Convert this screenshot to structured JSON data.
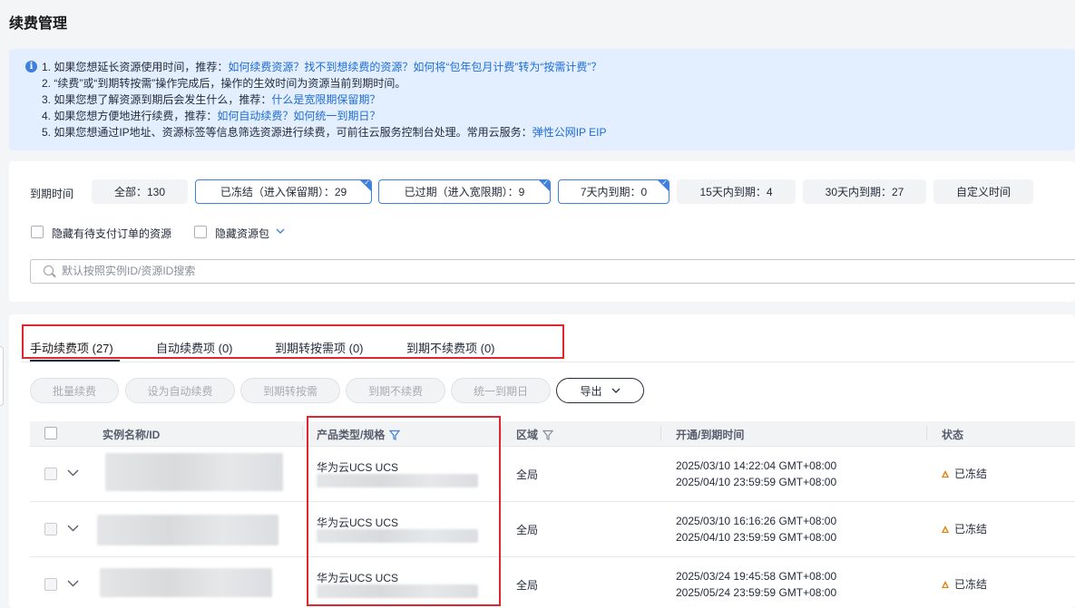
{
  "page": {
    "title": "续费管理"
  },
  "info": {
    "lines": [
      {
        "text": "1. 如果您想延长资源使用时间，推荐：",
        "link": "如何续费资源？找不到想续费的资源？如何将“包年包月计费”转为“按需计费”？"
      },
      {
        "text": "2. “续费”或“到期转按需”操作完成后，操作的生效时间为资源当前到期时间。",
        "link": ""
      },
      {
        "text": "3. 如果您想了解资源到期后会发生什么，推荐：",
        "link": "什么是宽限期保留期？"
      },
      {
        "text": "4. 如果您想方便地进行续费，推荐：",
        "link": "如何自动续费？如何统一到期日？"
      },
      {
        "text": "5. 如果您想通过IP地址、资源标签等信息筛选资源进行续费，可前往云服务控制台处理。常用云服务：",
        "link": "弹性公网IP EIP"
      }
    ]
  },
  "filter": {
    "label": "到期时间",
    "chips": [
      {
        "label": "全部：130",
        "selected": false
      },
      {
        "label": "已冻结（进入保留期）：29",
        "selected": true
      },
      {
        "label": "已过期（进入宽限期）：9",
        "selected": true
      },
      {
        "label": "7天内到期：0",
        "selected": true
      },
      {
        "label": "15天内到期：4",
        "selected": false
      },
      {
        "label": "30天内到期：27",
        "selected": false
      },
      {
        "label": "自定义时间",
        "selected": false
      }
    ],
    "checkbox_hide_pending": "隐藏有待支付订单的资源",
    "checkbox_hide_package": "隐藏资源包",
    "search_placeholder": "默认按照实例ID/资源ID搜索"
  },
  "tabs": [
    {
      "label": "手动续费项 (27)",
      "active": true
    },
    {
      "label": "自动续费项 (0)",
      "active": false
    },
    {
      "label": "到期转按需项 (0)",
      "active": false
    },
    {
      "label": "到期不续费项 (0)",
      "active": false
    }
  ],
  "toolbar": {
    "batch_renew": "批量续费",
    "set_auto_renew": "设为自动续费",
    "to_on_demand": "到期转按需",
    "no_renew": "到期不续费",
    "unify_expiry": "统一到期日",
    "export": "导出"
  },
  "table": {
    "headers": {
      "name": "实例名称/ID",
      "product": "产品类型/规格",
      "region": "区域",
      "time": "开通/到期时间",
      "status": "状态"
    },
    "rows": [
      {
        "product": "华为云UCS UCS",
        "region": "全局",
        "open": "2025/03/10 14:22:04 GMT+08:00",
        "expire": "2025/04/10 23:59:59 GMT+08:00",
        "status": "已冻结"
      },
      {
        "product": "华为云UCS UCS",
        "region": "全局",
        "open": "2025/03/10 16:16:26 GMT+08:00",
        "expire": "2025/04/10 23:59:59 GMT+08:00",
        "status": "已冻结"
      },
      {
        "product": "华为云UCS UCS",
        "region": "全局",
        "open": "2025/03/24 19:45:58 GMT+08:00",
        "expire": "2025/05/24 23:59:59 GMT+08:00",
        "status": "已冻结"
      }
    ]
  },
  "colors": {
    "accent": "#3f7fde",
    "link": "#1e6cd4",
    "highlight": "#e0262f",
    "warning": "#e37d00",
    "info_bg": "#e3efff"
  }
}
